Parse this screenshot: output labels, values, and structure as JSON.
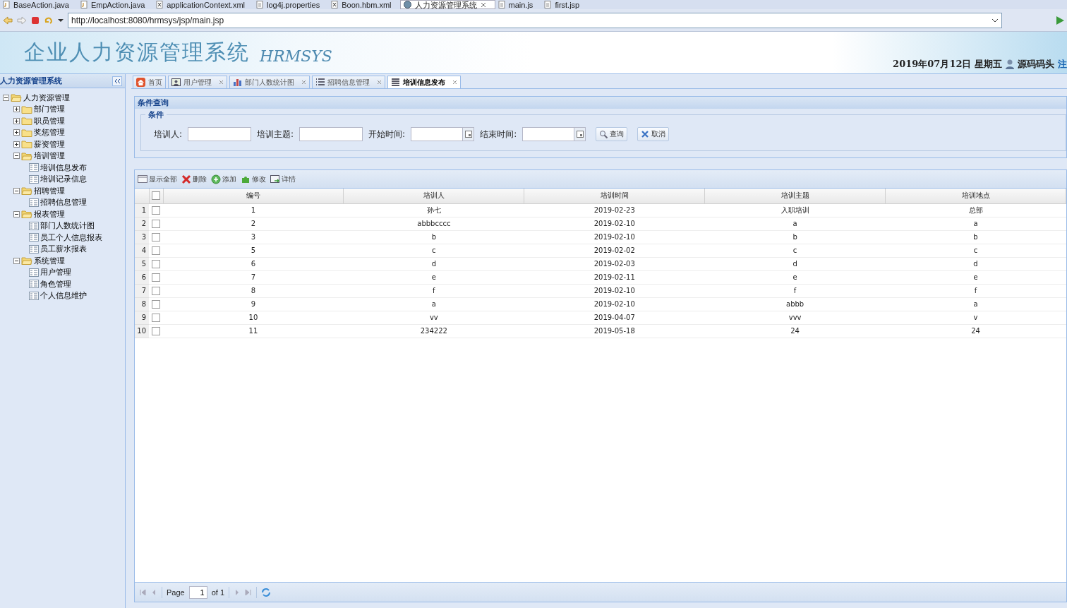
{
  "editor_tabs": [
    {
      "label": "BaseAction.java",
      "selected": false,
      "kind": "java"
    },
    {
      "label": "EmpAction.java",
      "selected": false,
      "kind": "java"
    },
    {
      "label": "applicationContext.xml",
      "selected": false,
      "kind": "xml"
    },
    {
      "label": "log4j.properties",
      "selected": false,
      "kind": "file"
    },
    {
      "label": "Boon.hbm.xml",
      "selected": false,
      "kind": "xml"
    },
    {
      "label": "人力资源管理系统",
      "selected": true,
      "kind": "web"
    },
    {
      "label": "main.js",
      "selected": false,
      "kind": "file"
    },
    {
      "label": "first.jsp",
      "selected": false,
      "kind": "file"
    }
  ],
  "browser": {
    "url": "http://localhost:8080/hrmsys/jsp/main.jsp"
  },
  "banner": {
    "title": "企业人力资源管理系统",
    "subtitle": "HRMSYS",
    "date": "2019年07月12日 星期五",
    "user": "源码码头",
    "link": "注"
  },
  "sidebar": {
    "title": "人力资源管理系统",
    "tree": [
      {
        "label": "人力资源管理",
        "kind": "folder",
        "expanded": true,
        "children": [
          {
            "label": "部门管理",
            "kind": "folder",
            "expanded": false
          },
          {
            "label": "职员管理",
            "kind": "folder",
            "expanded": false
          },
          {
            "label": "奖惩管理",
            "kind": "folder",
            "expanded": false
          },
          {
            "label": "薪资管理",
            "kind": "folder",
            "expanded": false
          },
          {
            "label": "培训管理",
            "kind": "folder",
            "expanded": true,
            "children": [
              {
                "label": "培训信息发布",
                "kind": "leaf"
              },
              {
                "label": "培训记录信息",
                "kind": "leaf"
              }
            ]
          },
          {
            "label": "招聘管理",
            "kind": "folder",
            "expanded": true,
            "children": [
              {
                "label": "招聘信息管理",
                "kind": "leaf"
              }
            ]
          },
          {
            "label": "报表管理",
            "kind": "folder",
            "expanded": true,
            "children": [
              {
                "label": "部门人数统计图",
                "kind": "leaf"
              },
              {
                "label": "员工个人信息报表",
                "kind": "leaf"
              },
              {
                "label": "员工薪水报表",
                "kind": "leaf"
              }
            ]
          },
          {
            "label": "系统管理",
            "kind": "folder",
            "expanded": true,
            "children": [
              {
                "label": "用户管理",
                "kind": "leaf"
              },
              {
                "label": "角色管理",
                "kind": "leaf"
              },
              {
                "label": "个人信息维护",
                "kind": "leaf"
              }
            ]
          }
        ]
      }
    ]
  },
  "tabs": [
    {
      "label": "首页",
      "kind": "home",
      "selected": false,
      "closable": false
    },
    {
      "label": "用户管理",
      "kind": "user",
      "selected": false,
      "closable": true
    },
    {
      "label": "部门人数统计图",
      "kind": "chart",
      "selected": false,
      "closable": true
    },
    {
      "label": "招聘信息管理",
      "kind": "list",
      "selected": false,
      "closable": true
    },
    {
      "label": "培训信息发布",
      "kind": "doc",
      "selected": true,
      "closable": true
    }
  ],
  "query_panel": {
    "title": "条件查询",
    "legend": "条件",
    "fields": [
      {
        "label": "培训人:",
        "kind": "text"
      },
      {
        "label": "培训主题:",
        "kind": "text"
      },
      {
        "label": "开始时间:",
        "kind": "date"
      },
      {
        "label": "结束时间:",
        "kind": "date"
      }
    ],
    "buttons": [
      {
        "label": "查询",
        "kind": "search"
      },
      {
        "label": "取消",
        "kind": "cancel"
      }
    ]
  },
  "toolbar": [
    {
      "label": "显示全部",
      "kind": "list"
    },
    {
      "label": "删除",
      "kind": "delete"
    },
    {
      "label": "添加",
      "kind": "add"
    },
    {
      "label": "修改",
      "kind": "edit"
    },
    {
      "label": "详情",
      "kind": "detail"
    }
  ],
  "table": {
    "columns": [
      "编号",
      "培训人",
      "培训时间",
      "培训主题",
      "培训地点"
    ],
    "all_checked": false,
    "rows": [
      {
        "index": "1",
        "checked": false,
        "cells": [
          "1",
          "孙七",
          "2019-02-23",
          "入职培训",
          "总部"
        ]
      },
      {
        "index": "2",
        "checked": false,
        "cells": [
          "2",
          "abbbcccc",
          "2019-02-10",
          "a",
          "a"
        ]
      },
      {
        "index": "3",
        "checked": false,
        "cells": [
          "3",
          "b",
          "2019-02-10",
          "b",
          "b"
        ]
      },
      {
        "index": "4",
        "checked": false,
        "cells": [
          "5",
          "c",
          "2019-02-02",
          "c",
          "c"
        ]
      },
      {
        "index": "5",
        "checked": false,
        "cells": [
          "6",
          "d",
          "2019-02-03",
          "d",
          "d"
        ]
      },
      {
        "index": "6",
        "checked": false,
        "cells": [
          "7",
          "e",
          "2019-02-11",
          "e",
          "e"
        ]
      },
      {
        "index": "7",
        "checked": false,
        "cells": [
          "8",
          "f",
          "2019-02-10",
          "f",
          "f"
        ]
      },
      {
        "index": "8",
        "checked": false,
        "cells": [
          "9",
          "a",
          "2019-02-10",
          "abbb",
          "a"
        ]
      },
      {
        "index": "9",
        "checked": false,
        "cells": [
          "10",
          "vv",
          "2019-04-07",
          "vvv",
          "v"
        ]
      },
      {
        "index": "10",
        "checked": false,
        "cells": [
          "11",
          "234222",
          "2019-05-18",
          "24",
          "24"
        ]
      }
    ]
  },
  "pager": {
    "label": "Page",
    "page": "1",
    "total": "of 1"
  }
}
